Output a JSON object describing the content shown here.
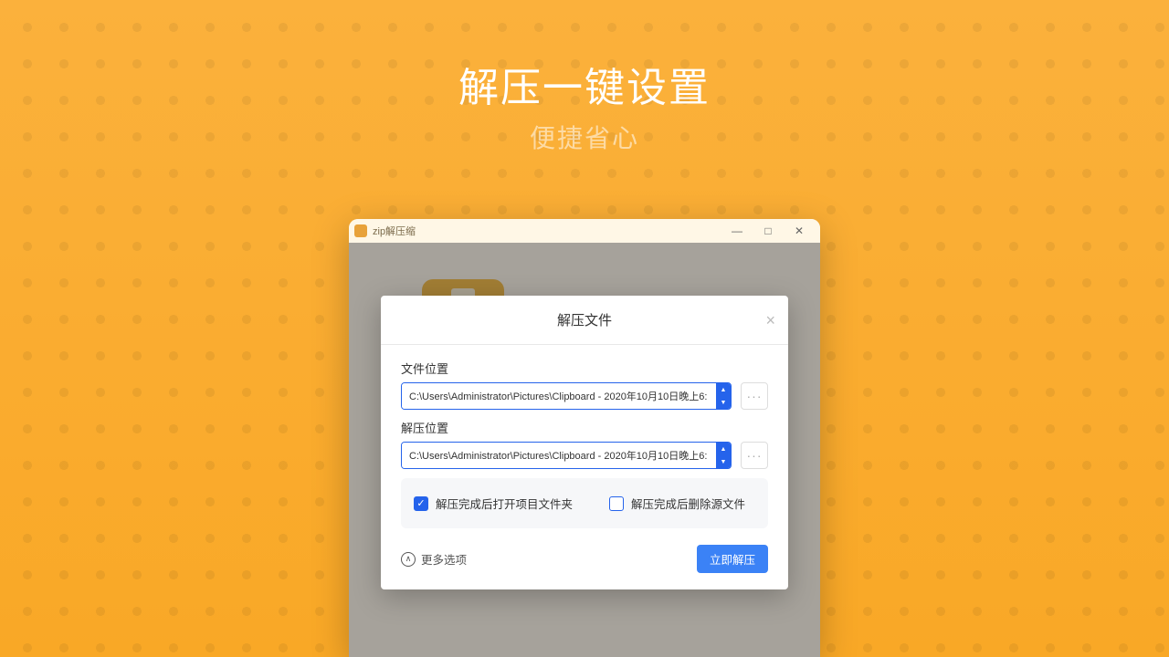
{
  "page": {
    "headline": "解压一键设置",
    "subhead": "便捷省心"
  },
  "window": {
    "title": "zip解压缩",
    "min": "—",
    "max": "□",
    "close": "✕"
  },
  "dialog": {
    "title": "解压文件",
    "close": "×",
    "file_location_label": "文件位置",
    "file_location_value": "C:\\Users\\Administrator\\Pictures\\Clipboard - 2020年10月10日晚上6:",
    "extract_location_label": "解压位置",
    "extract_location_value": "C:\\Users\\Administrator\\Pictures\\Clipboard - 2020年10月10日晚上6:",
    "browse": "···",
    "option_open_after": "解压完成后打开项目文件夹",
    "option_delete_source": "解压完成后删除源文件",
    "more_options": "更多选项",
    "more_icon": "∧",
    "submit": "立即解压",
    "checkmark": "✓"
  }
}
